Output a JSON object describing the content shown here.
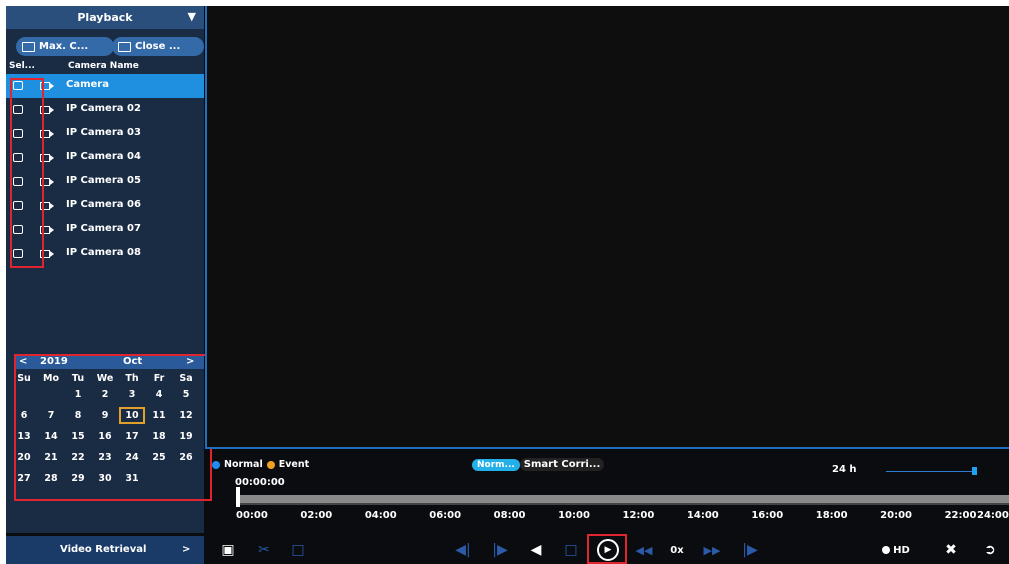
{
  "sidebar": {
    "title": "Playback",
    "max_button": "Max. C...",
    "close_button": "Close ...",
    "col_select": "Sel...",
    "col_name": "Camera Name",
    "cameras": [
      "Camera",
      "IP Camera 02",
      "IP Camera 03",
      "IP Camera 04",
      "IP Camera 05",
      "IP Camera 06",
      "IP Camera 07",
      "IP Camera 08"
    ],
    "video_retrieval": "Video Retrieval"
  },
  "calendar": {
    "year": "2019",
    "month": "Oct",
    "weekdays": [
      "Su",
      "Mo",
      "Tu",
      "We",
      "Th",
      "Fr",
      "Sa"
    ],
    "weeks": [
      [
        "",
        "",
        "1",
        "2",
        "3",
        "4",
        "5"
      ],
      [
        "6",
        "7",
        "8",
        "9",
        "10",
        "11",
        "12"
      ],
      [
        "13",
        "14",
        "15",
        "16",
        "17",
        "18",
        "19"
      ],
      [
        "20",
        "21",
        "22",
        "23",
        "24",
        "25",
        "26"
      ],
      [
        "27",
        "28",
        "29",
        "30",
        "31",
        "",
        ""
      ]
    ],
    "selected": "10"
  },
  "timeline": {
    "legend_normal": "Normal",
    "legend_event": "Event",
    "mode_active": "Norm...",
    "mode_rest": "Smart Corri...",
    "zoom_label": "24 h",
    "current_time": "00:00:00",
    "ticks": [
      "00:00",
      "02:00",
      "04:00",
      "06:00",
      "08:00",
      "10:00",
      "12:00",
      "14:00",
      "16:00",
      "18:00",
      "20:00",
      "22:00",
      "24:00"
    ]
  },
  "controls": {
    "speed": "0x",
    "quality": "HD"
  },
  "colors": {
    "normal": "#1e8cf0",
    "event": "#f0a020",
    "highlight": "#e0252e"
  }
}
